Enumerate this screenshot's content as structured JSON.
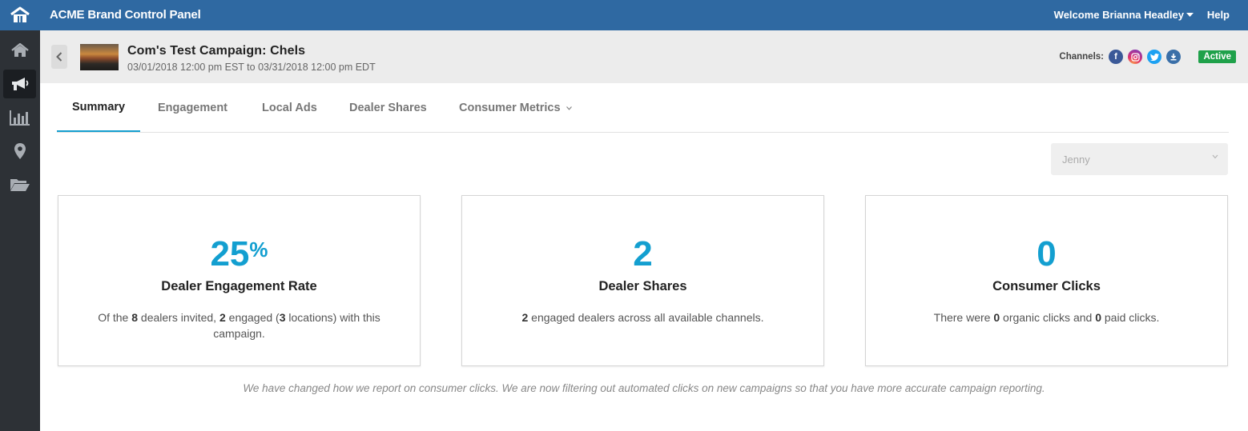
{
  "app": {
    "title": "ACME Brand Control Panel",
    "welcome": "Welcome Brianna Headley",
    "help": "Help"
  },
  "sidebar": {
    "items": [
      {
        "name": "home",
        "icon": "home-icon"
      },
      {
        "name": "campaigns",
        "icon": "megaphone-icon",
        "active": true
      },
      {
        "name": "reports",
        "icon": "bar-chart-icon"
      },
      {
        "name": "locations",
        "icon": "map-pin-icon"
      },
      {
        "name": "files",
        "icon": "folder-open-icon"
      }
    ]
  },
  "campaign": {
    "title": "Com's Test Campaign: Chels",
    "dates": "03/01/2018 12:00 pm EST to 03/31/2018 12:00 pm EDT",
    "channels_label": "Channels:",
    "channels": [
      {
        "name": "facebook",
        "glyph": "f",
        "color": "#3b5998"
      },
      {
        "name": "instagram",
        "glyph": "◎",
        "color": "#c13584"
      },
      {
        "name": "twitter",
        "glyph": "t",
        "color": "#1da1f2"
      },
      {
        "name": "download",
        "glyph": "⤓",
        "color": "#3a6fa8"
      }
    ],
    "status": "Active"
  },
  "tabs": [
    {
      "label": "Summary",
      "active": true
    },
    {
      "label": "Engagement"
    },
    {
      "label": "Local Ads"
    },
    {
      "label": "Dealer Shares"
    },
    {
      "label": "Consumer Metrics"
    }
  ],
  "dealer_select": {
    "value": "Jenny"
  },
  "cards": [
    {
      "value": "25",
      "suffix": "%",
      "title": "Dealer Engagement Rate",
      "desc_parts": [
        "Of the ",
        "8",
        " dealers invited, ",
        "2",
        " engaged (",
        "3",
        " locations) with this campaign."
      ]
    },
    {
      "value": "2",
      "suffix": "",
      "title": "Dealer Shares",
      "desc_parts": [
        "2",
        " engaged dealers across all available channels."
      ]
    },
    {
      "value": "0",
      "suffix": "",
      "title": "Consumer Clicks",
      "desc_parts": [
        "There were ",
        "0",
        " organic clicks and ",
        "0",
        " paid clicks."
      ]
    }
  ],
  "notice": "We have changed how we report on consumer clicks. We are now filtering out automated clicks on new campaigns so that you have more accurate campaign reporting.",
  "colors": {
    "topbar": "#2f69a2",
    "sidebar": "#2d3136",
    "accent": "#139fd0",
    "active_badge": "#1fa14a"
  }
}
